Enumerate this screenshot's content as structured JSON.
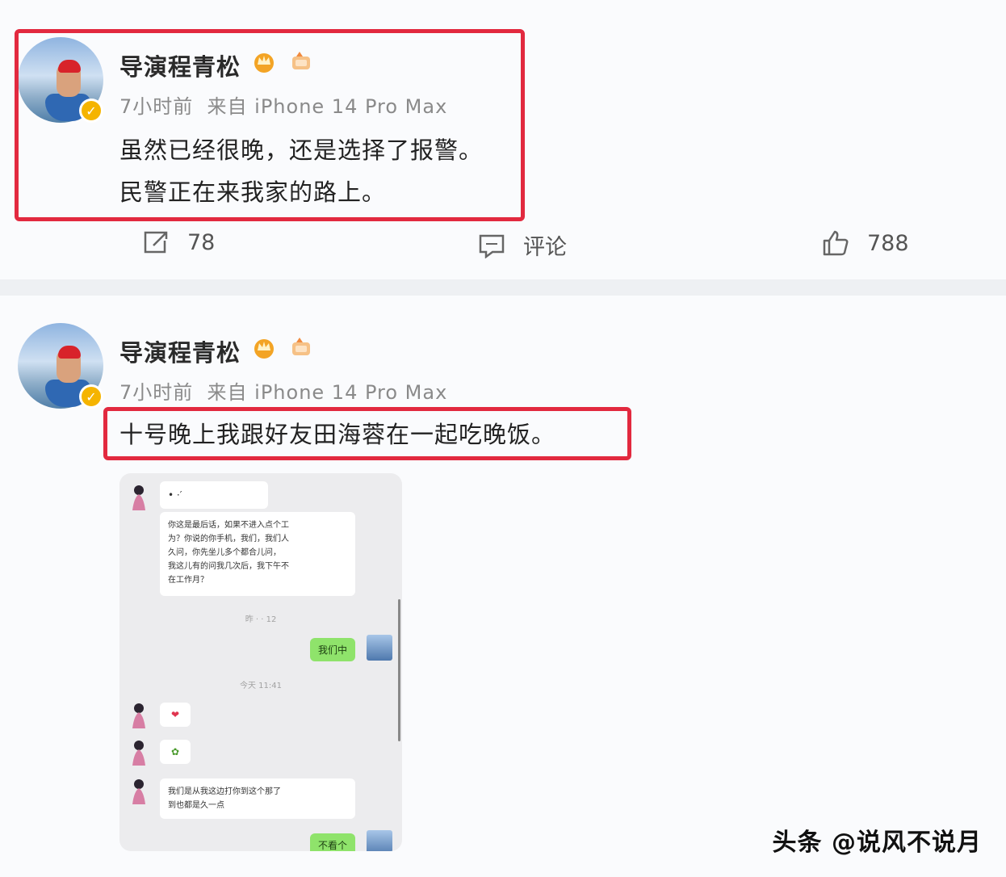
{
  "posts": [
    {
      "author": "导演程青松",
      "meta": "7小时前  来自 iPhone 14 Pro Max",
      "content_lines": [
        "虽然已经很晚，还是选择了报警。",
        "民警正在来我家的路上。"
      ],
      "actions": {
        "repost_count": "78",
        "comment_label": "评论",
        "like_count": "788"
      }
    },
    {
      "author": "导演程青松",
      "meta": "7小时前  来自 iPhone 14 Pro Max",
      "content_lines": [
        "十号晚上我跟好友田海蓉在一起吃晚饭。"
      ],
      "chat": {
        "msg_top": "• ·′",
        "msg_long": "你这是最后话，如果不进入点个工\n为？你说的你手机，我们，我们人\n久问，你先坐儿多个都合儿问，\n我这儿有的问我几次后，我下午不\n在工作月？",
        "time1": "昨 · · 12",
        "reply1": "我们中",
        "time2": "今天 11:41",
        "msg_heart": "❤",
        "msg_flower": "✿",
        "msg_last": "我们是从我这边打你到这个那了\n到也都是久一点",
        "reply2": "不看个"
      }
    }
  ],
  "watermark": "头条 @说风不说月",
  "colors": {
    "highlight_border": "#e2293f",
    "badge": "#f5b400",
    "wechat_green": "#8fe36b"
  }
}
